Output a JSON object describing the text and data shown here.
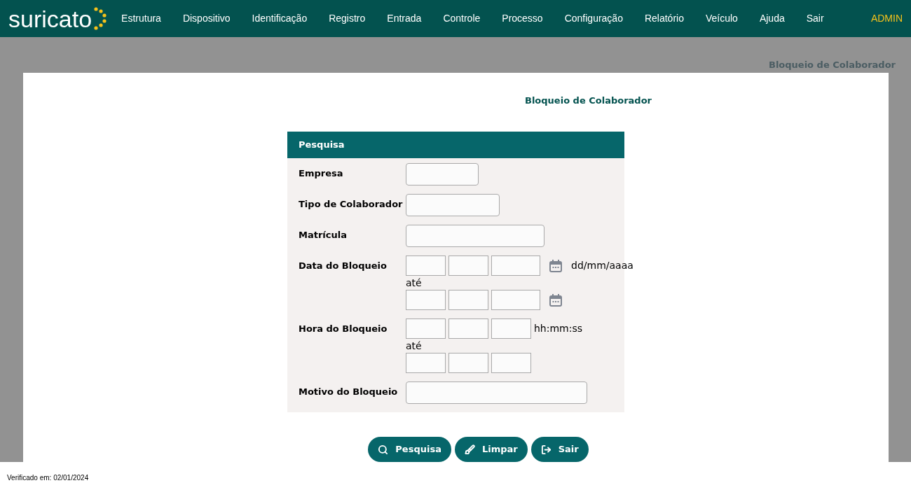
{
  "header": {
    "logo": "suricato",
    "menu": [
      "Estrutura",
      "Dispositivo",
      "Identificação",
      "Registro",
      "Entrada",
      "Controle",
      "Processo",
      "Configuração",
      "Relatório",
      "Veículo",
      "Ajuda",
      "Sair"
    ],
    "user": "ADMIN"
  },
  "breadcrumb": "Bloqueio de Colaborador",
  "page_title": "Bloqueio de Colaborador",
  "form": {
    "title": "Pesquisa",
    "fields": [
      {
        "kind": "text",
        "label": "Empresa"
      },
      {
        "kind": "text",
        "label": "Tipo de Colaborador"
      },
      {
        "kind": "text",
        "label": "Matrícula"
      },
      {
        "kind": "date",
        "label": "Data do Bloqueio",
        "hint": "dd/mm/aaaa",
        "separator": "até"
      },
      {
        "kind": "time",
        "label": "Hora do Bloqueio",
        "hint": "hh:mm:ss",
        "separator": "até"
      },
      {
        "kind": "text",
        "label": "Motivo do Bloqueio"
      }
    ]
  },
  "buttons": [
    {
      "kind": "search",
      "label": "Pesquisa"
    },
    {
      "kind": "clear",
      "label": "Limpar"
    },
    {
      "kind": "exit",
      "label": "Sair"
    }
  ],
  "footer": "Verificado em: 02/01/2024"
}
